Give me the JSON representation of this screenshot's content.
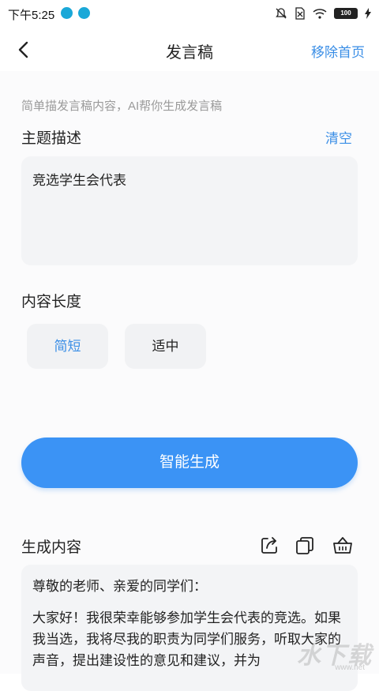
{
  "status_bar": {
    "time": "下午5:25",
    "battery": "100"
  },
  "header": {
    "title": "发言稿",
    "action_label": "移除首页"
  },
  "hint": "简单描发言稿内容，AI帮你生成发言稿",
  "topic": {
    "label": "主题描述",
    "clear_label": "清空",
    "value": "竞选学生会代表"
  },
  "length": {
    "label": "内容长度",
    "options": [
      "简短",
      "适中"
    ],
    "selected": "简短"
  },
  "generate_button": "智能生成",
  "result": {
    "label": "生成内容",
    "paragraphs": [
      "尊敬的老师、亲爱的同学们：",
      "大家好！我很荣幸能够参加学生会代表的竞选。如果我当选，我将尽我的职责为同学们服务，听取大家的声音，提出建设性的意见和建议，并为"
    ]
  },
  "watermark": {
    "main": "水下载",
    "sub": "www.net"
  },
  "colors": {
    "accent": "#3a8ee6",
    "button": "#3b93f5",
    "field_bg": "#f3f4f6"
  }
}
